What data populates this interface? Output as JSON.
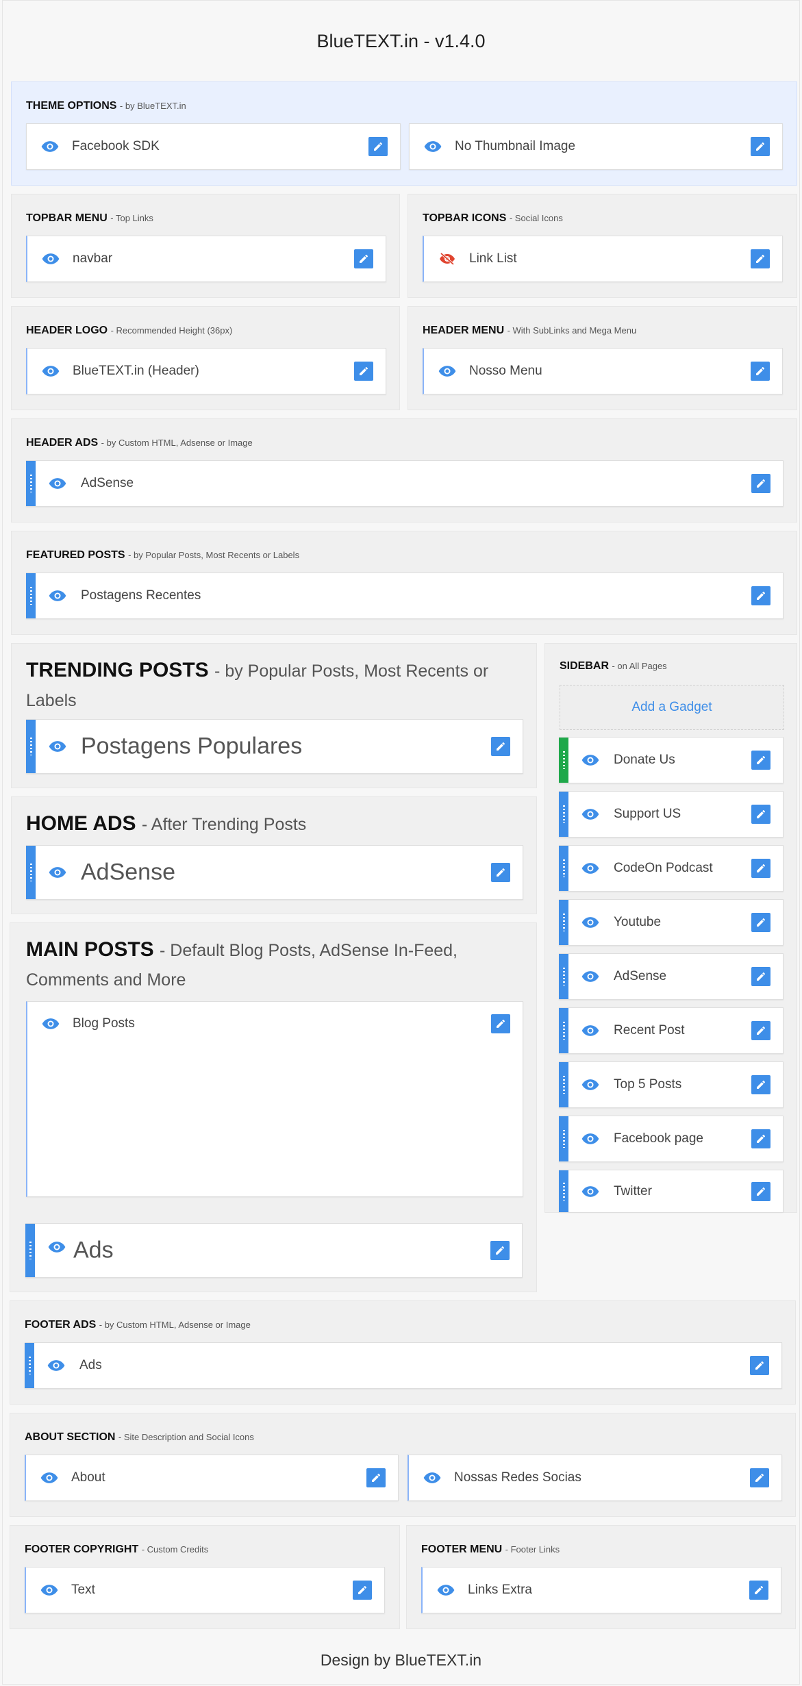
{
  "header": {
    "title": "BlueTEXT.in - v1.4.0"
  },
  "sections": {
    "theme_options": {
      "title": "THEME OPTIONS",
      "subtitle": "- by BlueTEXT.in",
      "widgets": [
        "Facebook SDK",
        "No Thumbnail Image"
      ]
    },
    "topbar_menu": {
      "title": "TOPBAR MENU",
      "subtitle": "- Top Links",
      "widgets": [
        "navbar"
      ]
    },
    "topbar_icons": {
      "title": "TOPBAR ICONS",
      "subtitle": "- Social Icons",
      "widgets": [
        "Link List"
      ]
    },
    "header_logo": {
      "title": "HEADER LOGO",
      "subtitle": "- Recommended Height (36px)",
      "widgets": [
        "BlueTEXT.in (Header)"
      ]
    },
    "header_menu": {
      "title": "HEADER MENU",
      "subtitle": "- With SubLinks and Mega Menu",
      "widgets": [
        "Nosso Menu"
      ]
    },
    "header_ads": {
      "title": "HEADER ADS",
      "subtitle": "- by Custom HTML, Adsense or Image",
      "widgets": [
        "AdSense"
      ]
    },
    "featured_posts": {
      "title": "FEATURED POSTS",
      "subtitle": "- by Popular Posts, Most Recents or Labels",
      "widgets": [
        "Postagens Recentes"
      ]
    },
    "trending_posts": {
      "title": "TRENDING POSTS",
      "subtitle": "- by Popular Posts, Most Recents or Labels",
      "widgets": [
        "Postagens Populares"
      ]
    },
    "home_ads": {
      "title": "HOME ADS",
      "subtitle": "- After Trending Posts",
      "widgets": [
        "AdSense"
      ]
    },
    "main_posts": {
      "title": "MAIN POSTS",
      "subtitle": "- Default Blog Posts, AdSense In-Feed, Comments and More",
      "widgets": [
        "Blog Posts",
        "Ads"
      ]
    },
    "sidebar": {
      "title": "SIDEBAR",
      "subtitle": "- on All Pages",
      "add_gadget": "Add a Gadget",
      "widgets": [
        "Donate Us",
        "Support US",
        "CodeOn Podcast",
        "Youtube",
        "AdSense",
        "Recent Post",
        "Top 5 Posts",
        "Facebook page",
        "Twitter"
      ]
    },
    "footer_ads": {
      "title": "FOOTER ADS",
      "subtitle": "- by Custom HTML, Adsense or Image",
      "widgets": [
        "Ads"
      ]
    },
    "about_section": {
      "title": "ABOUT SECTION",
      "subtitle": "- Site Description and Social Icons",
      "widgets": [
        "About",
        "Nossas Redes Socias"
      ]
    },
    "footer_copyright": {
      "title": "FOOTER COPYRIGHT",
      "subtitle": "- Custom Credits",
      "widgets": [
        "Text"
      ]
    },
    "footer_menu": {
      "title": "FOOTER MENU",
      "subtitle": "- Footer Links",
      "widgets": [
        "Links Extra"
      ]
    }
  },
  "footer": {
    "credit": "Design by BlueTEXT.in"
  },
  "colors": {
    "accent": "#3e8ee8",
    "hidden_icon": "#e0442f",
    "drag_active": "#1fa84a"
  },
  "icons": {
    "visible": "eye-icon",
    "hidden": "eye-off-icon",
    "edit": "pencil-icon"
  }
}
